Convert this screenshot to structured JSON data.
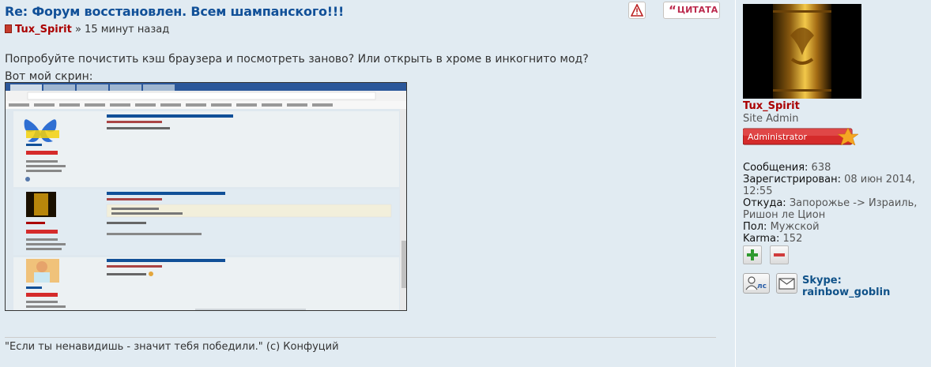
{
  "post": {
    "title": "Re: Форум восстановлен. Всем шампанского!!!",
    "author": "Tux_Spirit",
    "time_sep": "»",
    "time": "15 минут назад",
    "content_line1": "Попробуйте почистить кэш браузера и посмотреть заново? Или открыть в хроме в инкогнито мод?",
    "content_line2": "Вот мой скрин:",
    "signature": "\"Если ты ненавидишь - значит тебя победили.\" (с) Конфуций",
    "buttons": {
      "report_icon": "warning-icon",
      "quote_label": "ЦИТАТА"
    }
  },
  "screenshot": {
    "post_title": "Re: Форум восстановлен. Всем шампанского!!!",
    "post_title_2": "Re: Форум восстановлен. Всем шампанского!!!",
    "post_title_3": "Re: Форум восстановлен. Всем шампанского!!!"
  },
  "profile": {
    "username": "Tux_Spirit",
    "rank": "Site Admin",
    "rank_badge": "Administrator",
    "stats": [
      {
        "label": "Сообщения:",
        "value": "638"
      },
      {
        "label": "Зарегистрирован:",
        "value": "08 июн 2014, 12:55"
      },
      {
        "label": "Откуда:",
        "value": "Запорожье -> Израиль, Ришон ле Цион"
      },
      {
        "label": "Пол:",
        "value": "Мужской"
      },
      {
        "label": "Karma:",
        "value": "152"
      }
    ],
    "karma_plus_icon": "plus-icon",
    "karma_minus_icon": "minus-icon",
    "pm_label": "лс",
    "skype_label": "Skype:",
    "skype_name": "rainbow_goblin"
  },
  "colors": {
    "background": "#e1ebf2",
    "title": "#115098",
    "author": "#aa0000",
    "quote": "#bc2a4d",
    "badge_red": "#d52b2b",
    "badge_star": "#f5a623"
  }
}
